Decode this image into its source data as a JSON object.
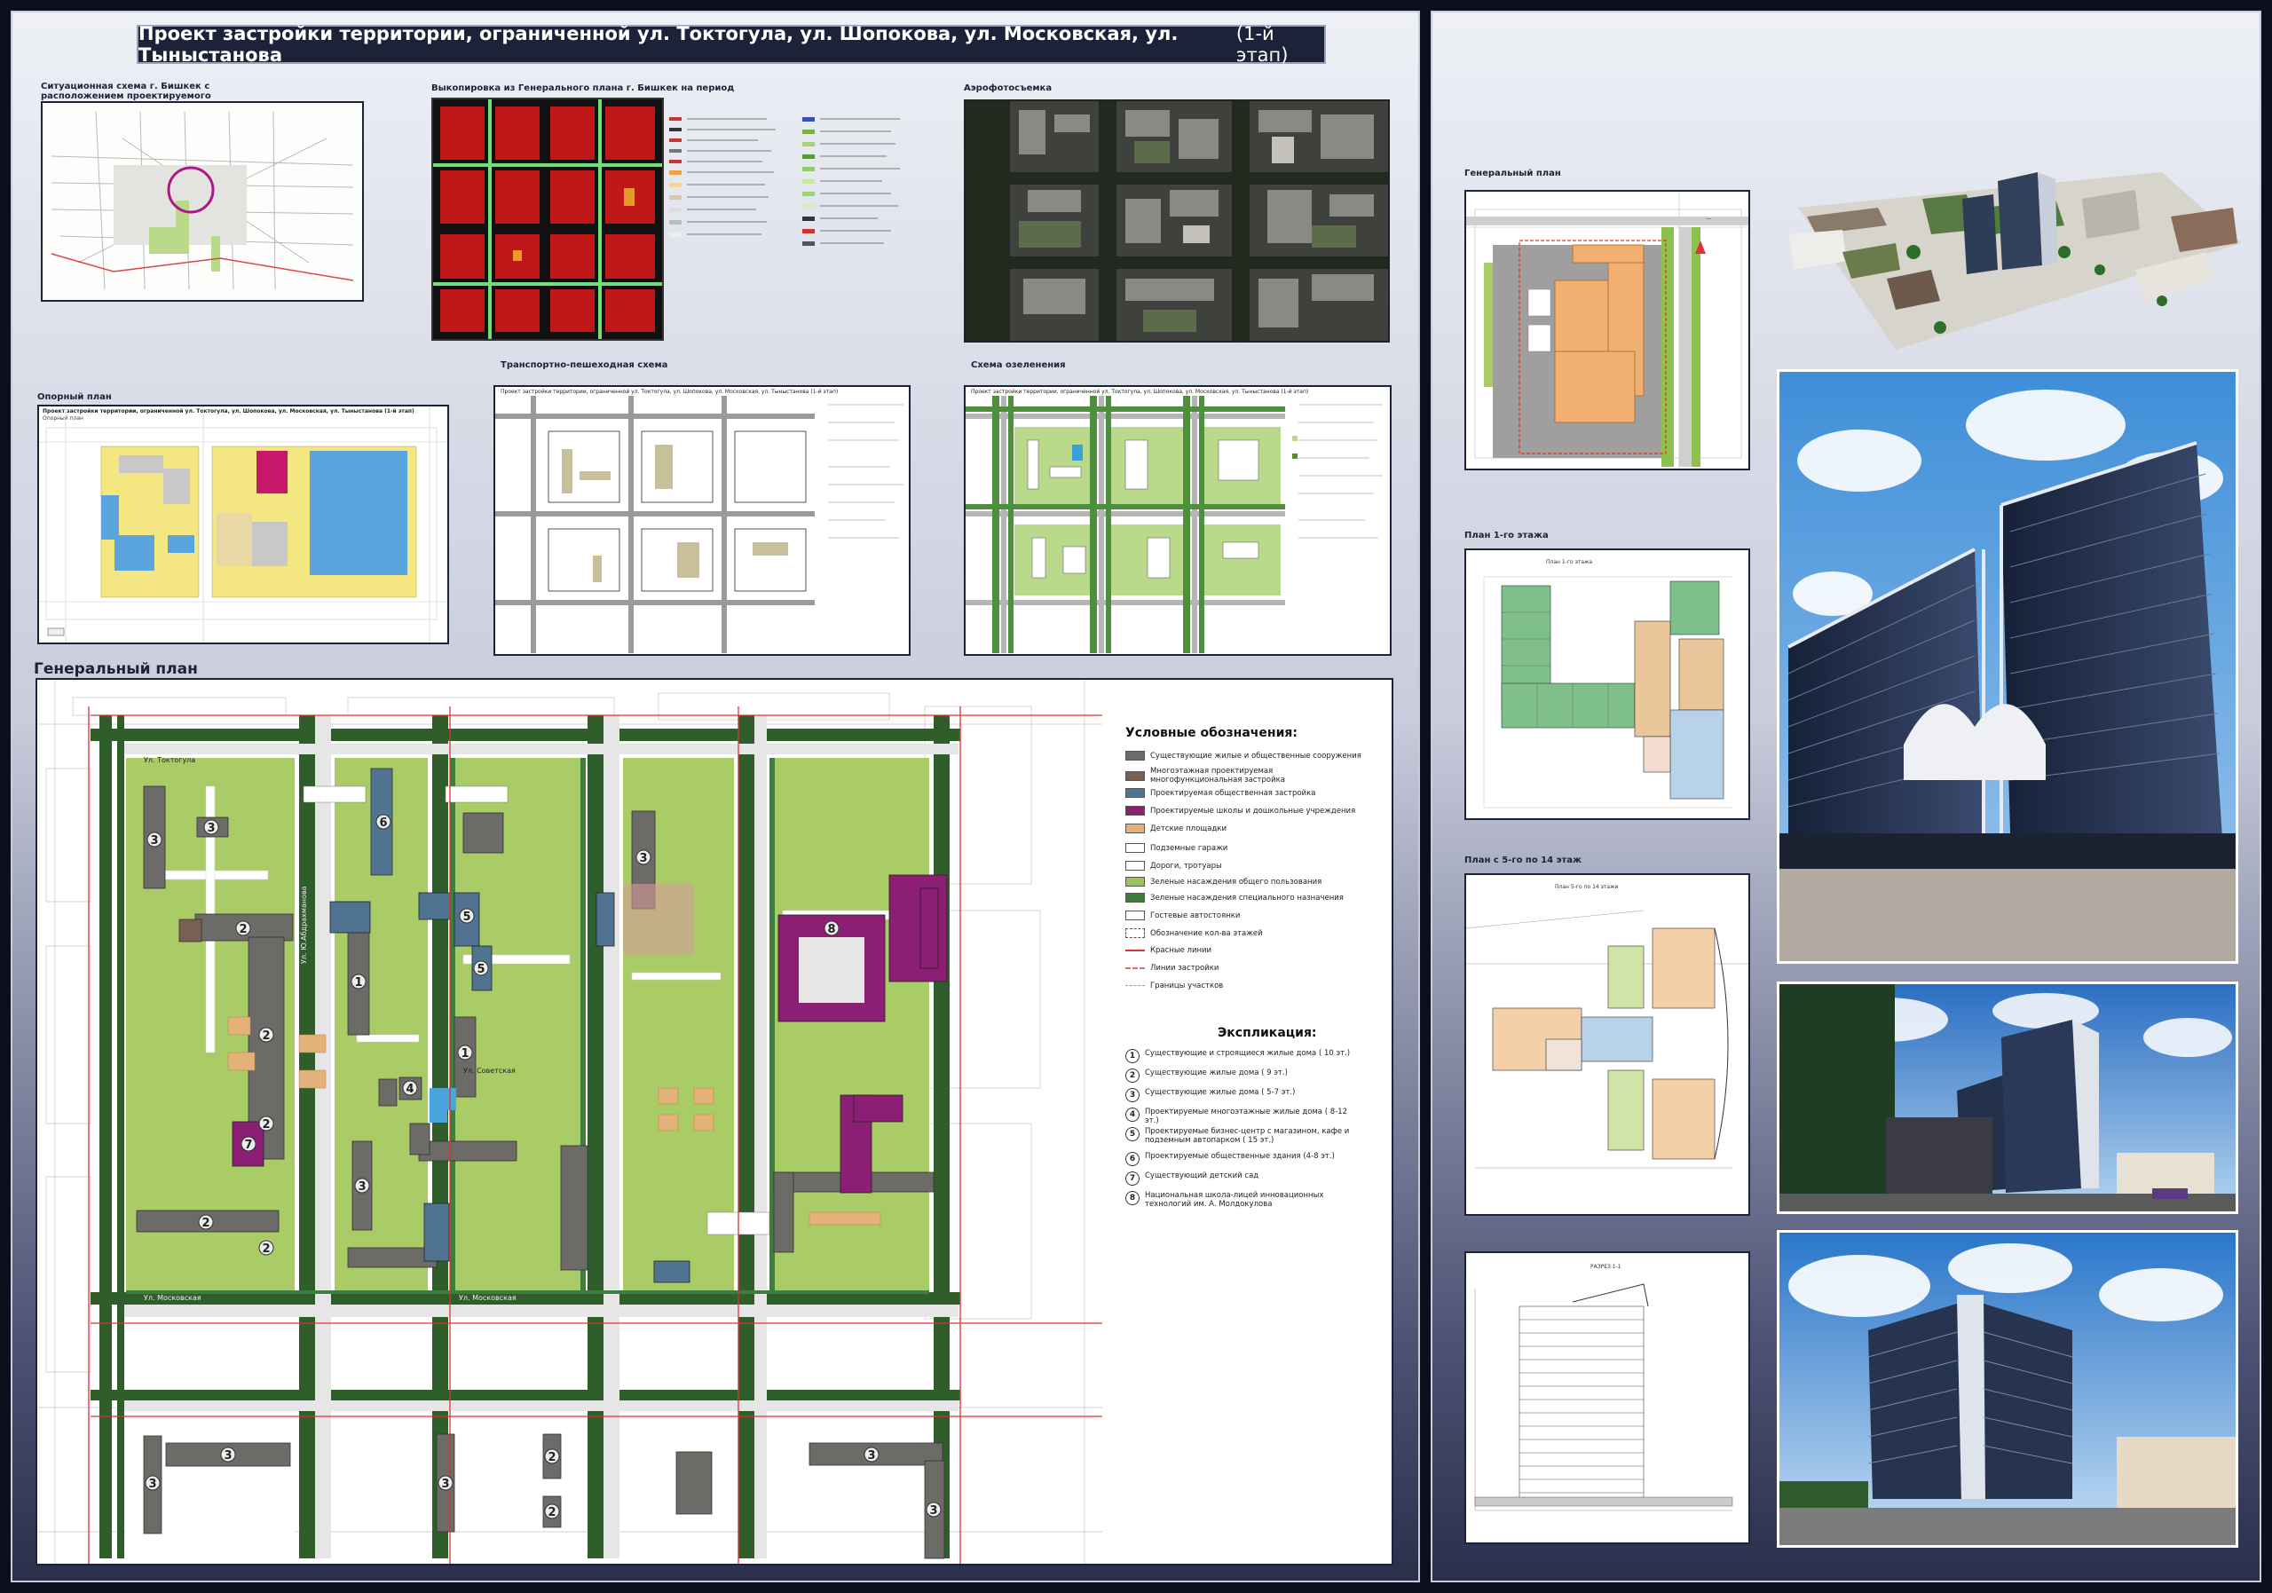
{
  "header": {
    "title": "Проект застройки территории, ограниченной ул. Токтогула, ул. Шопокова, ул. Московская, ул. Тыныстанова",
    "stage": "(1-й этап)"
  },
  "left": {
    "situation_caption_1": "Ситуационная схема г. Бишкек с",
    "situation_caption_2": "расположением проектируемого",
    "genplan_extract_caption": "Выкопировка из Генерального плана г. Бишкек на период",
    "aerial_caption": "Аэрофотосъемка",
    "support_plan_caption": "Опорный план",
    "transport_caption": "Транспортно-пешеходная схема",
    "greening_caption": "Схема озеленения",
    "main_plan_caption": "Генеральный план",
    "support_plan_inner_title": "Проект застройки территории, ограниченной ул. Токтогула, ул. Шопокова, ул. Московская, ул. Тыныстанова (1-й этап)",
    "support_plan_inner_sub": "Опорный план",
    "transport_inner_title": "Проект застройки территории, ограниченной ул. Токтогула, ул. Шопокова, ул. Московская, ул. Тыныстанова (1-й этап)",
    "greening_inner_title": "Проект застройки территории, ограниченной ул. Токтогула, ул. Шопокова, ул. Московская, ул. Тыныстанова (1-й этап)"
  },
  "legend": {
    "title": "Условные обозначения:",
    "items": [
      {
        "label": "Существующие жилые и общественные сооружения",
        "color": "#6d6b67"
      },
      {
        "label": "Многоэтажная проектируемая многофункциональная застройка",
        "color": "#7a5f54"
      },
      {
        "label": "Проектируемая общественная застройка",
        "color": "#4f7391"
      },
      {
        "label": "Проектируемые школы и дошкольные учреждения",
        "color": "#8c1f74"
      },
      {
        "label": "Детские площадки",
        "color": "#e2b27a"
      },
      {
        "label": "Подземные гаражи",
        "color": "#ffffff"
      },
      {
        "label": "Дороги, тротуары",
        "color": "#ffffff"
      },
      {
        "label": "Зеленые насаждения общего пользования",
        "color": "#9cc35a"
      },
      {
        "label": "Зеленые насаждения специального назначения",
        "color": "#3f7d3a"
      },
      {
        "label": "Гостевые автостоянки",
        "color": "#ffffff"
      },
      {
        "label": "Обозначение кол-ва этажей",
        "color": "#ffffff"
      },
      {
        "label": "Красные линии",
        "color": "#d33"
      },
      {
        "label": "Линии застройки",
        "color": "#e07070"
      },
      {
        "label": "Границы участков",
        "color": "#999"
      }
    ]
  },
  "explication": {
    "title": "Экспликация:",
    "items": [
      {
        "num": "1",
        "label": "Существующие и строящиеся жилые дома ( 10 эт.)"
      },
      {
        "num": "2",
        "label": "Существующие жилые дома ( 9 эт.)"
      },
      {
        "num": "3",
        "label": "Существующие жилые дома ( 5-7 эт.)"
      },
      {
        "num": "4",
        "label": "Проектируемые многоэтажные жилые дома ( 8-12 эт.)"
      },
      {
        "num": "5",
        "label": "Проектируемые бизнес-центр с магазином, кафе и подземным автопарком ( 15 эт.)"
      },
      {
        "num": "6",
        "label": "Проектируемые общественные здания (4-8 эт.)"
      },
      {
        "num": "7",
        "label": "Существующий детский сад"
      },
      {
        "num": "8",
        "label": "Национальная школа-лицей инновационных технологий им. А. Молдокулова"
      }
    ]
  },
  "streets": {
    "toktogula": "Ул. Токтогула",
    "moskovskaya_1": "Ул. Московская",
    "moskovskaya_2": "Ул. Московская",
    "abdrakhmanova": "Ул. Ю.Абдрахманова",
    "sovetskaya": "Ул. Советская"
  },
  "right": {
    "genplan_caption": "Генеральный план",
    "floor1_caption": "План 1-го этажа",
    "floors_caption": "План с 5-го по 14 этаж",
    "floor1_inner_title": "План 1-го этажа",
    "floors_inner_title": "План 5-го по 14 этажи",
    "section_inner_title": "РАЗРЕЗ 1-1"
  },
  "colors": {
    "title_bg": "#1c2238",
    "existing_building": "#6d6b67",
    "school": "#8c1f74",
    "public": "#4f7391",
    "green_public": "#9cc35a",
    "green_special": "#3f7d3a"
  }
}
